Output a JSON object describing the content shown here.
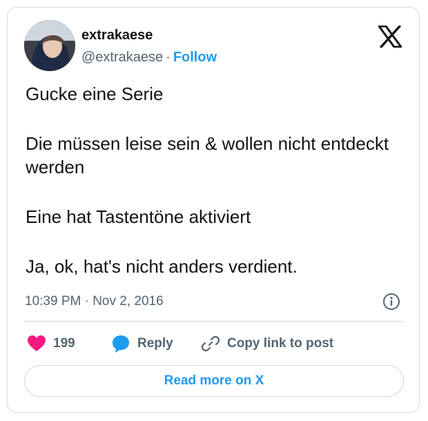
{
  "author": {
    "display_name": "extrakaese",
    "handle": "@extrakaese",
    "separator": "·",
    "follow_label": "Follow",
    "avatar_icon": "user-avatar-photo"
  },
  "brand": {
    "logo_icon": "x-logo-icon"
  },
  "tweet": {
    "paragraphs": [
      "Gucke eine Serie",
      "Die müssen leise sein & wollen nicht entdeckt werden",
      "Eine hat Tastentöne aktiviert",
      "Ja, ok, hat's nicht anders verdient."
    ],
    "timestamp": "10:39 PM · Nov 2, 2016"
  },
  "actions": {
    "like_count": "199",
    "reply_label": "Reply",
    "copy_label": "Copy link to post",
    "read_more_label": "Read more on X"
  },
  "colors": {
    "accent": "#1d9bf0",
    "like": "#f91880",
    "text": "#0f1419",
    "muted": "#536471",
    "border": "#cfd9de"
  }
}
